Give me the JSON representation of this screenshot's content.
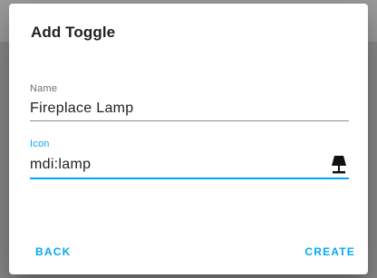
{
  "dialog": {
    "title": "Add Toggle",
    "name_field": {
      "label": "Name",
      "value": "Fireplace Lamp"
    },
    "icon_field": {
      "label": "Icon",
      "value": "mdi:lamp",
      "icon": "lamp-icon"
    },
    "actions": {
      "back_label": "BACK",
      "create_label": "CREATE"
    }
  },
  "colors": {
    "accent": "#03a9f4",
    "text": "#212121",
    "label": "#6f6f6f",
    "backdrop": "#8a8a8a"
  }
}
